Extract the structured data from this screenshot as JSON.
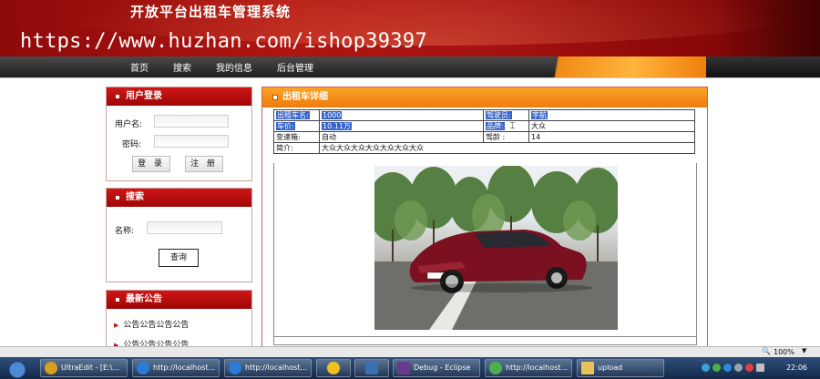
{
  "header": {
    "site_title": "开放平台出租车管理系统",
    "watermark": "https://www.huzhan.com/ishop39397"
  },
  "nav": {
    "items": [
      "首页",
      "搜索",
      "我的信息",
      "后台管理"
    ]
  },
  "login": {
    "title": "用户登录",
    "username_label": "用户名:",
    "password_label": "密码:",
    "login_button": "登 录",
    "register_button": "注 册"
  },
  "search": {
    "title": "搜索",
    "name_label": "名称:",
    "query_button": "查询"
  },
  "notice": {
    "title": "最新公告",
    "items": [
      "公告公告公告公告",
      "公告公告公告公告"
    ]
  },
  "detail": {
    "title": "出租车详细",
    "rows": [
      {
        "k1": "出租车名:",
        "v1": "1000",
        "k2": "驾驶员:",
        "v2": "宇航"
      },
      {
        "k1": "车价:",
        "v1": "10.11万",
        "k2": "品牌:",
        "v2": "大众"
      },
      {
        "k1": "变速箱:",
        "v1": "自动",
        "k2": "驾龄 :",
        "v2": "14"
      }
    ],
    "intro_label": "简介:",
    "intro_value": "大众大众大众大众大众大众大众"
  },
  "statusbar": {
    "zoom": "100%"
  },
  "taskbar": {
    "items": [
      {
        "label": "UltraEdit - [E:\\...",
        "icon_color": "#d8a020"
      },
      {
        "label": "http://localhost...",
        "icon_color": "#2b7bd8"
      },
      {
        "label": "http://localhost...",
        "icon_color": "#2b7bd8"
      },
      {
        "label": "",
        "icon_color": "#f0c020"
      },
      {
        "label": "",
        "icon_color": "#3a6fb0"
      },
      {
        "label": "Debug - Eclipse",
        "icon_color": "#6a3a8a"
      },
      {
        "label": "http://localhost...",
        "icon_color": "#4bb04b"
      },
      {
        "label": "upload",
        "icon_color": "#e7c35a"
      }
    ],
    "time": "22:06"
  },
  "colors": {
    "banner_red": "#a51210",
    "nav_dark": "#2a2a2a",
    "panel_red": "#c40f0f",
    "main_orange": "#f59018",
    "selection_blue": "#3563c9"
  }
}
